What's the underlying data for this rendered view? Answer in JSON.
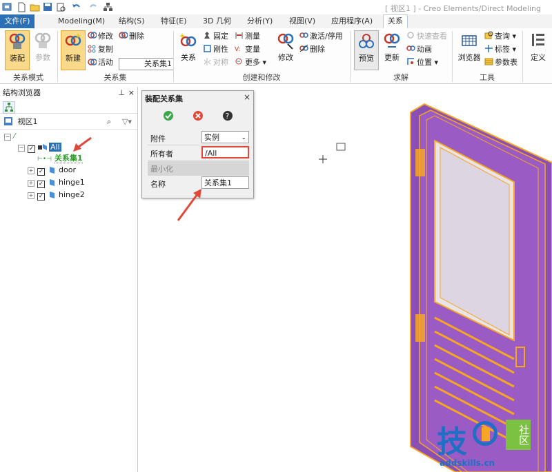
{
  "window": {
    "title": "[ 视区1 ] - Creo Elements/Direct Modeling"
  },
  "tabs": [
    {
      "label": "文件(F)"
    },
    {
      "label": "Modeling(M)"
    },
    {
      "label": "结构(S)"
    },
    {
      "label": "特征(E)"
    },
    {
      "label": "3D 几何"
    },
    {
      "label": "分析(Y)"
    },
    {
      "label": "视图(V)"
    },
    {
      "label": "应用程序(A)"
    },
    {
      "label": "关系"
    }
  ],
  "ribbon": {
    "groups": {
      "mode": "关系模式",
      "set": "关系集",
      "create": "创建和修改",
      "solve": "求解",
      "tools": "工具"
    },
    "assembly": "装配",
    "params": "参数",
    "new": "新建",
    "modify": "修改",
    "delete": "删除",
    "copy": "复制",
    "active": "活动",
    "set_value": "关系集1",
    "relation": "关系",
    "fix": "固定",
    "measure": "测量",
    "rigid": "刚性",
    "variable": "变量",
    "symmetric": "对称",
    "more": "更多",
    "modify2": "修改",
    "activate": "激活/停用",
    "delete2": "删除",
    "preview": "预览",
    "update": "更新",
    "quick_view": "快速查看",
    "animation": "动画",
    "position": "位置",
    "browser": "浏览器",
    "query": "查询",
    "label": "标签",
    "param_table": "参数表",
    "define": "定义"
  },
  "browser": {
    "title": "结构浏览器",
    "view": "视区1",
    "tree": [
      {
        "label": "All"
      },
      {
        "label": "关系集1"
      },
      {
        "label": "door"
      },
      {
        "label": "hinge1"
      },
      {
        "label": "hinge2"
      }
    ]
  },
  "dialog": {
    "title": "装配关系集",
    "rows": {
      "attachment_label": "附件",
      "attachment_value": "实例",
      "owner_label": "所有者",
      "owner_value": "/All",
      "minimize": "最小化",
      "name_label": "名称",
      "name_value": "关系集1"
    }
  },
  "watermark": {
    "text": "addskills.cn",
    "brand": "技",
    "community": "社区"
  },
  "colors": {
    "accent": "#2b6fb6",
    "arrow": "#e0483a",
    "door_face": "#8a4fb4",
    "door_edge": "#f5a623"
  }
}
